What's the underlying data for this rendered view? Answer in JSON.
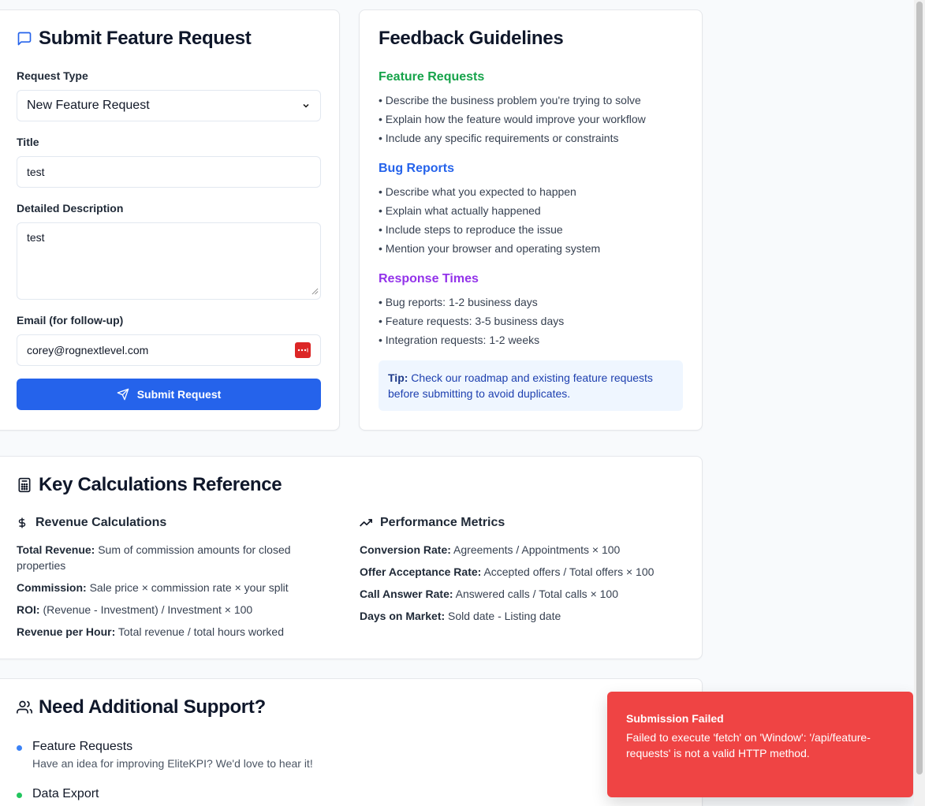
{
  "submit_form": {
    "title": "Submit Feature Request",
    "request_type_label": "Request Type",
    "request_type_value": "New Feature Request",
    "title_label": "Title",
    "title_value": "test",
    "description_label": "Detailed Description",
    "description_value": "test",
    "email_label": "Email (for follow-up)",
    "email_value": "corey@rognextlevel.com",
    "submit_label": "Submit Request"
  },
  "guidelines": {
    "title": "Feedback Guidelines",
    "sections": [
      {
        "heading": "Feature Requests",
        "color": "#16a34a",
        "items": [
          "• Describe the business problem you're trying to solve",
          "• Explain how the feature would improve your workflow",
          "• Include any specific requirements or constraints"
        ]
      },
      {
        "heading": "Bug Reports",
        "color": "#2563eb",
        "items": [
          "• Describe what you expected to happen",
          "• Explain what actually happened",
          "• Include steps to reproduce the issue",
          "• Mention your browser and operating system"
        ]
      },
      {
        "heading": "Response Times",
        "color": "#9333ea",
        "items": [
          "• Bug reports: 1-2 business days",
          "• Feature requests: 3-5 business days",
          "• Integration requests: 1-2 weeks"
        ]
      }
    ],
    "tip_label": "Tip:",
    "tip_text": "Check our roadmap and existing feature requests before submitting to avoid duplicates."
  },
  "calculations": {
    "title": "Key Calculations Reference",
    "revenue": {
      "heading": "Revenue Calculations",
      "items": [
        {
          "term": "Total Revenue:",
          "desc": "Sum of commission amounts for closed properties"
        },
        {
          "term": "Commission:",
          "desc": "Sale price × commission rate × your split"
        },
        {
          "term": "ROI:",
          "desc": "(Revenue - Investment) / Investment × 100"
        },
        {
          "term": "Revenue per Hour:",
          "desc": "Total revenue / total hours worked"
        }
      ]
    },
    "performance": {
      "heading": "Performance Metrics",
      "items": [
        {
          "term": "Conversion Rate:",
          "desc": "Agreements / Appointments × 100"
        },
        {
          "term": "Offer Acceptance Rate:",
          "desc": "Accepted offers / Total offers × 100"
        },
        {
          "term": "Call Answer Rate:",
          "desc": "Answered calls / Total calls × 100"
        },
        {
          "term": "Days on Market:",
          "desc": "Sold date - Listing date"
        }
      ]
    }
  },
  "support": {
    "title": "Need Additional Support?",
    "items": [
      {
        "title": "Feature Requests",
        "desc": "Have an idea for improving EliteKPI? We'd love to hear it!",
        "color": "#3b82f6"
      },
      {
        "title": "Data Export",
        "desc": "",
        "color": "#22c55e"
      }
    ]
  },
  "toast": {
    "title": "Submission Failed",
    "message": "Failed to execute 'fetch' on 'Window': '/api/feature-requests' is not a valid HTTP method.",
    "color": "#ef4444"
  },
  "icons": {
    "form_icon": "message-square-icon",
    "calc_icon": "calculator-icon",
    "support_icon": "users-icon",
    "revenue_icon": "dollar-sign-icon",
    "performance_icon": "trending-up-icon",
    "submit_icon": "send-icon",
    "password_manager_icon": "password-manager-icon"
  }
}
